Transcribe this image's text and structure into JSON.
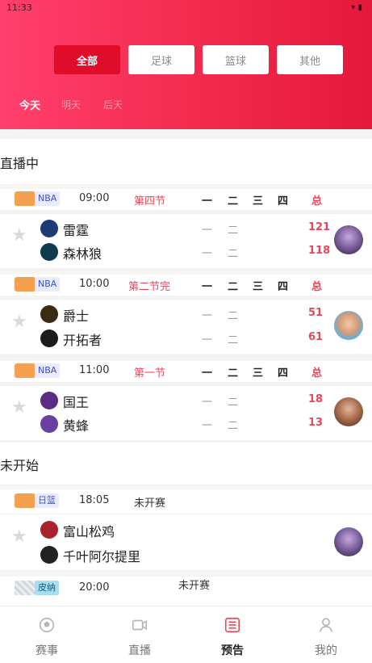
{
  "status_bar": {
    "time": "11:33",
    "icons": "▾ ▮"
  },
  "categories": [
    "全部",
    "足球",
    "篮球",
    "其他"
  ],
  "days": [
    "今天",
    "明天",
    "后天"
  ],
  "sections": {
    "live": "直播中",
    "upcoming": "未开始"
  },
  "quarters": [
    "一",
    "二",
    "三",
    "四"
  ],
  "quarter_dashes": [
    "一",
    "二"
  ],
  "total_label": "总",
  "matches": [
    {
      "league": "NBA",
      "time": "09:00",
      "status": "第四节",
      "home": {
        "name": "雷霆",
        "score": "121"
      },
      "away": {
        "name": "森林狼",
        "score": "118"
      }
    },
    {
      "league": "NBA",
      "time": "10:00",
      "status": "第二节完",
      "home": {
        "name": "爵士",
        "score": "51"
      },
      "away": {
        "name": "开拓者",
        "score": "61"
      }
    },
    {
      "league": "NBA",
      "time": "11:00",
      "status": "第一节",
      "home": {
        "name": "国王",
        "score": "18"
      },
      "away": {
        "name": "黄蜂",
        "score": "13"
      }
    },
    {
      "league": "日篮",
      "time": "18:05",
      "status": "未开赛",
      "home": {
        "name": "富山松鸡"
      },
      "away": {
        "name": "千叶阿尔提里"
      }
    },
    {
      "league": "皮纳",
      "time": "20:00",
      "status": "未开赛"
    }
  ],
  "bottom_nav": [
    {
      "label": "赛事",
      "icon": "soccer-ball-icon"
    },
    {
      "label": "直播",
      "icon": "video-camera-icon"
    },
    {
      "label": "预告",
      "icon": "list-icon"
    },
    {
      "label": "我的",
      "icon": "user-icon"
    }
  ],
  "colors": {
    "header_start": "#ff3f6c",
    "header_end": "#e5183b",
    "accent": "#e00d2a",
    "score": "#e8475a"
  }
}
